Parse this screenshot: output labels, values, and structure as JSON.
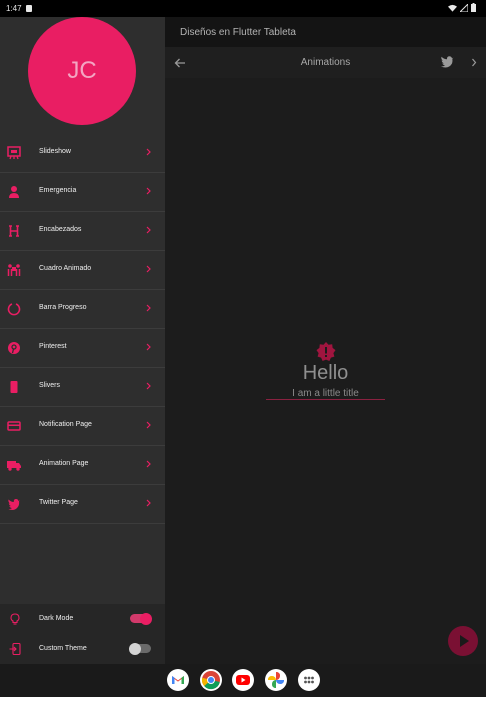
{
  "status_bar": {
    "time": "1:47"
  },
  "drawer": {
    "avatar_initials": "JC",
    "items": [
      {
        "label": "Slideshow",
        "icon": "slideshow-icon"
      },
      {
        "label": "Emergencia",
        "icon": "ambulance-icon"
      },
      {
        "label": "Encabezados",
        "icon": "heading-icon"
      },
      {
        "label": "Cuadro Animado",
        "icon": "people-carry-icon"
      },
      {
        "label": "Barra Progreso",
        "icon": "circle-notch-icon"
      },
      {
        "label": "Pinterest",
        "icon": "pinterest-icon"
      },
      {
        "label": "Slivers",
        "icon": "mobile-icon"
      },
      {
        "label": "Notification Page",
        "icon": "credit-card-icon"
      },
      {
        "label": "Animation Page",
        "icon": "truck-icon"
      },
      {
        "label": "Twitter Page",
        "icon": "twitter-icon"
      }
    ],
    "settings": [
      {
        "label": "Dark Mode",
        "icon": "lightbulb-icon",
        "on": true
      },
      {
        "label": "Custom Theme",
        "icon": "add-to-mobile-icon",
        "on": false
      }
    ]
  },
  "app_bar": {
    "title": "Diseños en Flutter Tableta"
  },
  "toolbar": {
    "title": "Animations"
  },
  "content": {
    "hello": "Hello",
    "subtitle": "I am a little title"
  },
  "taskbar": {
    "apps": [
      "gmail-icon",
      "chrome-icon",
      "youtube-icon",
      "photos-icon",
      "app-drawer-icon"
    ]
  },
  "colors": {
    "accent": "#e91e63",
    "drawer_bg": "#2e2e2e",
    "content_bg": "#1c1c1c",
    "fab": "#7a1033"
  }
}
